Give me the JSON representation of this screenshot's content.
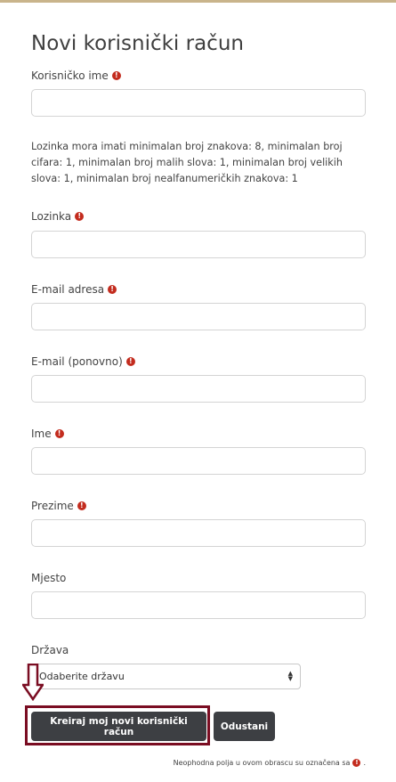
{
  "form": {
    "title": "Novi korisnički račun",
    "username": {
      "label": "Korisničko ime",
      "value": ""
    },
    "password_policy": "Lozinka mora imati minimalan broj znakova: 8, minimalan broj cifara: 1, minimalan broj malih slova: 1, minimalan broj velikih slova: 1, minimalan broj nealfanumeričkih znakova: 1",
    "password": {
      "label": "Lozinka",
      "value": ""
    },
    "email": {
      "label": "E-mail adresa",
      "value": ""
    },
    "email_repeat": {
      "label": "E-mail (ponovno)",
      "value": ""
    },
    "first_name": {
      "label": "Ime",
      "value": ""
    },
    "last_name": {
      "label": "Prezime",
      "value": ""
    },
    "city": {
      "label": "Mjesto",
      "value": ""
    },
    "country": {
      "label": "Država",
      "selected": "Odaberite državu"
    },
    "required_glyph": "!",
    "buttons": {
      "create": "Kreiraj moj novi korisnički račun",
      "cancel": "Odustani"
    },
    "required_note": "Neophodna polja u ovom obrascu su označena sa"
  },
  "colors": {
    "accent_border": "#c9b48b",
    "required_icon": "#c32c1e",
    "button_bg": "#3d3f43",
    "highlight": "#7a0d22"
  }
}
